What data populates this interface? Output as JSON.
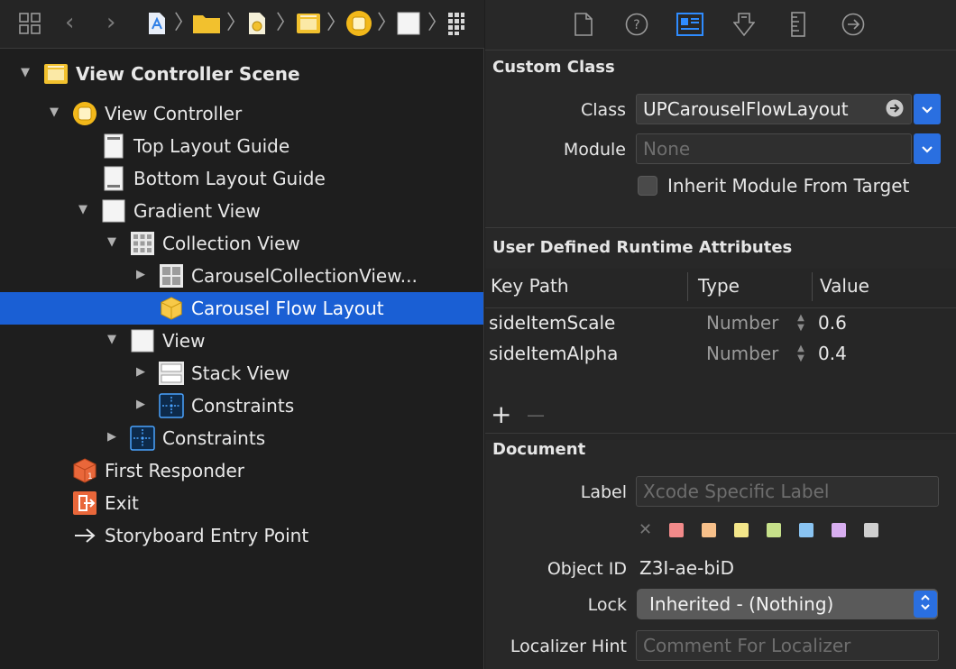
{
  "outline": {
    "rows": [
      {
        "label": "View Controller Scene",
        "icon": "scene-icon"
      },
      {
        "label": "View Controller",
        "icon": "view-controller-icon"
      },
      {
        "label": "Top Layout Guide",
        "icon": "layout-guide-icon"
      },
      {
        "label": "Bottom Layout Guide",
        "icon": "layout-guide-icon"
      },
      {
        "label": "Gradient View",
        "icon": "view-icon"
      },
      {
        "label": "Collection View",
        "icon": "collection-view-icon"
      },
      {
        "label": "CarouselCollectionView...",
        "icon": "cell-icon"
      },
      {
        "label": "Carousel Flow Layout",
        "icon": "layout-object-icon"
      },
      {
        "label": "View",
        "icon": "view-icon"
      },
      {
        "label": "Stack View",
        "icon": "stack-view-icon"
      },
      {
        "label": "Constraints",
        "icon": "constraints-icon"
      },
      {
        "label": "Constraints",
        "icon": "constraints-icon"
      },
      {
        "label": "First Responder",
        "icon": "first-responder-icon"
      },
      {
        "label": "Exit",
        "icon": "exit-icon"
      },
      {
        "label": "Storyboard Entry Point",
        "icon": "arrow-right-icon"
      }
    ]
  },
  "inspector": {
    "custom_class": {
      "title": "Custom Class",
      "class_label": "Class",
      "class_value": "UPCarouselFlowLayout",
      "module_label": "Module",
      "module_placeholder": "None",
      "inherit_label": "Inherit Module From Target"
    },
    "runtime_attributes": {
      "title": "User Defined Runtime Attributes",
      "columns": [
        "Key Path",
        "Type",
        "Value"
      ],
      "rows": [
        {
          "key": "sideItemScale",
          "type": "Number",
          "value": "0.6"
        },
        {
          "key": "sideItemAlpha",
          "type": "Number",
          "value": "0.4"
        }
      ],
      "add": "+",
      "remove": "—"
    },
    "document": {
      "title": "Document",
      "label_label": "Label",
      "label_placeholder": "Xcode Specific Label",
      "clear_glyph": "✕",
      "object_id_label": "Object ID",
      "object_id_value": "Z3I-ae-biD",
      "lock_label": "Lock",
      "lock_value": "Inherited - (Nothing)",
      "hint_label": "Localizer Hint",
      "hint_placeholder": "Comment For Localizer"
    }
  },
  "colors": {
    "selection": "#1a5fd4",
    "accent": "#2a6fe0",
    "swatches": [
      "#f28a8a",
      "#f7c08a",
      "#f3e68a",
      "#c6e08a",
      "#8ac4f2",
      "#d8aef0",
      "#cfcfcf"
    ]
  }
}
